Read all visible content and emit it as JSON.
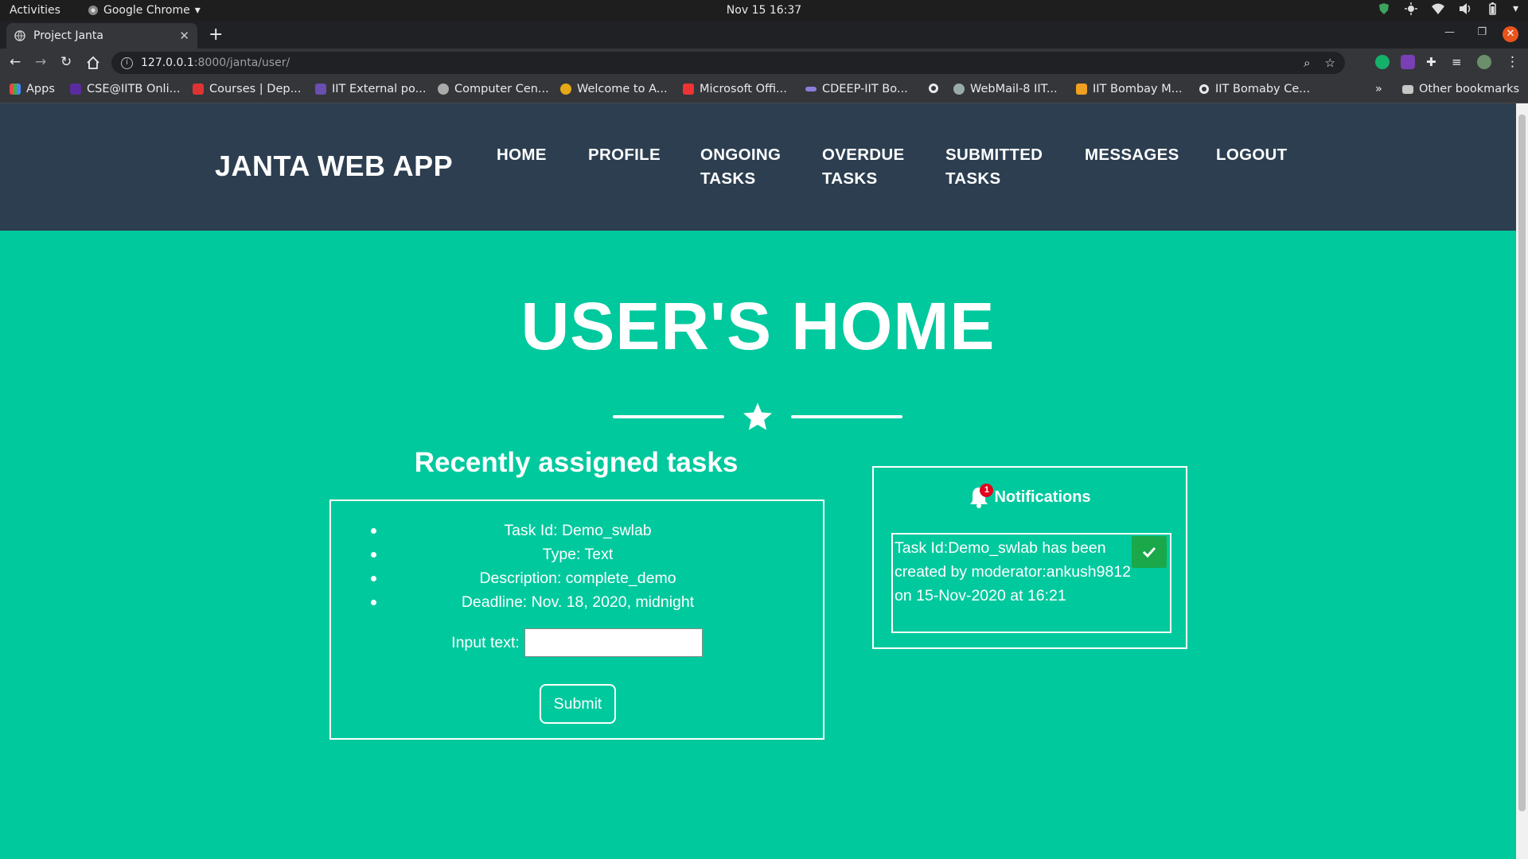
{
  "system_bar": {
    "activities": "Activities",
    "app_name": "Google Chrome",
    "clock": "Nov 15  16:37"
  },
  "browser": {
    "tab_title": "Project Janta",
    "url_host": "127.0.0.1",
    "url_path": ":8000/janta/user/",
    "bookmarks": [
      "Apps",
      "CSE@IITB Onli...",
      "Courses | Dep...",
      "IIT External po...",
      "Computer Cen...",
      "Welcome to A...",
      "Microsoft Offi...",
      "CDEEP-IIT Bo...",
      "",
      "WebMail-8 IIT...",
      "IIT Bombay M...",
      "IIT Bomaby Ce..."
    ],
    "other_bookmarks": "Other bookmarks",
    "overflow": "»"
  },
  "site": {
    "brand": "JANTA WEB APP",
    "nav": [
      {
        "line1": "HOME",
        "line2": ""
      },
      {
        "line1": "PROFILE",
        "line2": ""
      },
      {
        "line1": "ONGOING",
        "line2": "TASKS"
      },
      {
        "line1": "OVERDUE",
        "line2": "TASKS"
      },
      {
        "line1": "SUBMITTED",
        "line2": "TASKS"
      },
      {
        "line1": "MESSAGES",
        "line2": ""
      },
      {
        "line1": "LOGOUT",
        "line2": ""
      }
    ],
    "colors": {
      "nav_bg": "#2c3e50",
      "page_bg": "#00c99e",
      "accept": "#1aa84a",
      "badge": "#e3001b"
    }
  },
  "main": {
    "title": "USER'S HOME",
    "section_title": "Recently assigned tasks",
    "task": {
      "id": "Task Id: Demo_swlab",
      "type": "Type: Text",
      "description": "Description: complete_demo",
      "deadline": "Deadline: Nov. 18, 2020, midnight"
    },
    "input_label": "Input text:",
    "input_value": "",
    "submit_label": "Submit"
  },
  "notifications": {
    "title": "Notifications",
    "count": "1",
    "items": [
      {
        "text": "Task Id:Demo_swlab has been created by moderator:ankush9812 on 15-Nov-2020 at 16:21"
      }
    ]
  }
}
